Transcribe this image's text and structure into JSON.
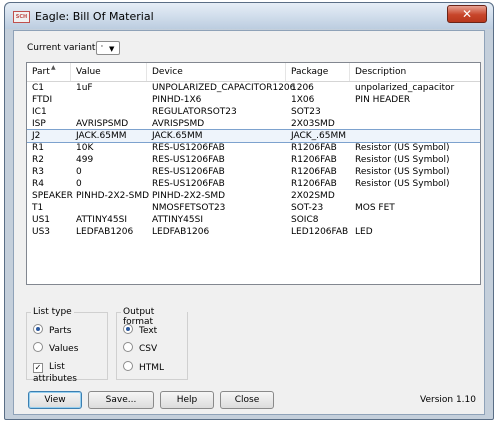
{
  "app": {
    "icon_text": "SCH",
    "title": "Eagle: Bill Of Material",
    "close_symbol": "✕"
  },
  "variant": {
    "label": "Current variant",
    "value": "'",
    "arrow": "▼"
  },
  "table": {
    "headers": [
      "Part",
      "Value",
      "Device",
      "Package",
      "Description"
    ],
    "sort_indicator": "▲",
    "selected_index": 4,
    "rows": [
      [
        "C1",
        "1uF",
        "UNPOLARIZED_CAPACITOR1206",
        "1206",
        "unpolarized_capacitor"
      ],
      [
        "FTDI",
        "",
        "PINHD-1X6",
        "1X06",
        "PIN HEADER"
      ],
      [
        "IC1",
        "",
        "REGULATORSOT23",
        "SOT23",
        ""
      ],
      [
        "ISP",
        "AVRISPSMD",
        "AVRISPSMD",
        "2X03SMD",
        ""
      ],
      [
        "J2",
        "JACK.65MM",
        "JACK.65MM",
        "JACK_.65MM",
        ""
      ],
      [
        "R1",
        "10K",
        "RES-US1206FAB",
        "R1206FAB",
        "Resistor (US Symbol)"
      ],
      [
        "R2",
        "499",
        "RES-US1206FAB",
        "R1206FAB",
        "Resistor (US Symbol)"
      ],
      [
        "R3",
        "0",
        "RES-US1206FAB",
        "R1206FAB",
        "Resistor (US Symbol)"
      ],
      [
        "R4",
        "0",
        "RES-US1206FAB",
        "R1206FAB",
        "Resistor (US Symbol)"
      ],
      [
        "SPEAKER",
        "PINHD-2X2-SMD",
        "PINHD-2X2-SMD",
        "2X02SMD",
        ""
      ],
      [
        "T1",
        "",
        "NMOSFETSOT23",
        "SOT-23",
        "MOS FET"
      ],
      [
        "US1",
        "ATTINY45SI",
        "ATTINY45SI",
        "SOIC8",
        ""
      ],
      [
        "US3",
        "LEDFAB1206",
        "LEDFAB1206",
        "LED1206FAB",
        "LED"
      ]
    ]
  },
  "list_type": {
    "title": "List type",
    "parts": "Parts",
    "values": "Values",
    "attributes": "List attributes",
    "selected": "parts",
    "attributes_checked": true
  },
  "output_format": {
    "title": "Output format",
    "text": "Text",
    "csv": "CSV",
    "html": "HTML",
    "selected": "text"
  },
  "buttons": {
    "view": "View",
    "save": "Save...",
    "help": "Help",
    "close": "Close"
  },
  "version": "Version 1.10"
}
